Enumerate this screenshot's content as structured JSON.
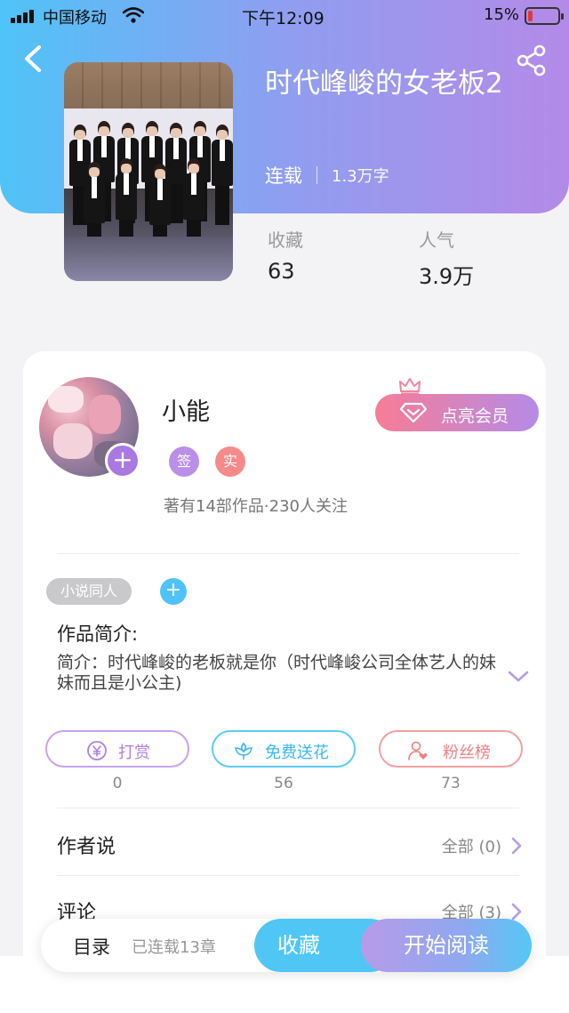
{
  "status_bar": {
    "carrier": "中国移动",
    "time": "下午12:09",
    "battery": "15%"
  },
  "book": {
    "title": "时代峰峻的女老板2",
    "status": "连载",
    "word_count": "1.3万字",
    "stats": [
      {
        "label": "收藏",
        "value": "63"
      },
      {
        "label": "人气",
        "value": "3.9万"
      }
    ]
  },
  "author": {
    "name": "小能",
    "badges": [
      "签",
      "实"
    ],
    "summary": "著有14部作品·230人关注",
    "vip_label": "点亮会员"
  },
  "tags": [
    "小说同人"
  ],
  "intro": {
    "heading": "作品简介:",
    "text": "简介：时代峰峻的老板就是你（时代峰峻公司全体艺人的妹妹而且是小公主)"
  },
  "actions": [
    {
      "label": "打赏",
      "count": "0",
      "icon": "yen-coin-icon",
      "color": "#b27fe0"
    },
    {
      "label": "免费送花",
      "count": "56",
      "icon": "flower-icon",
      "color": "#3ab8ee"
    },
    {
      "label": "粉丝榜",
      "count": "73",
      "icon": "user-heart-icon",
      "color": "#ee7f80"
    }
  ],
  "sections": [
    {
      "title": "作者说",
      "right": "全部 (0)"
    },
    {
      "title": "评论",
      "right": "全部 (3)"
    }
  ],
  "bottom_bar": {
    "toc": "目录",
    "chapters": "已连载13章",
    "collect": "收藏",
    "read": "开始阅读"
  },
  "colors": {
    "header_start": "#4fc3f7",
    "header_end": "#b48ae8",
    "accent_blue": "#50c6f5",
    "accent_purple": "#b79be8"
  }
}
